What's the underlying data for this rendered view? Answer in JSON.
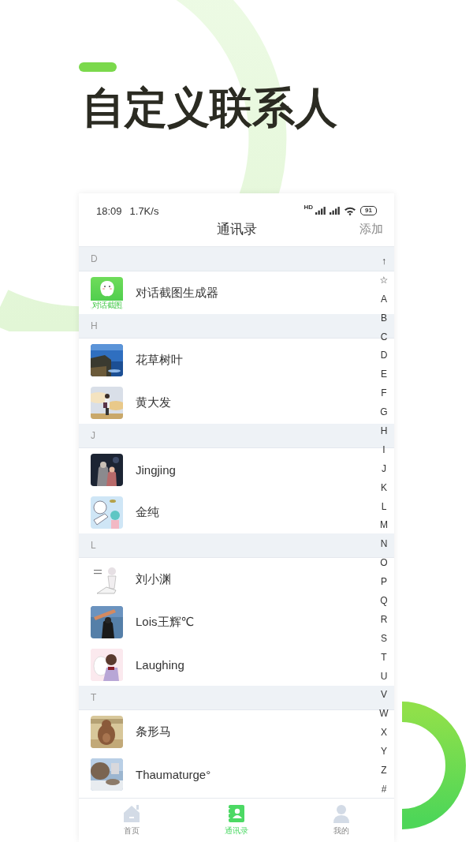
{
  "headline": "自定义联系人",
  "status_bar": {
    "time": "18:09",
    "speed": "1.7K/s",
    "network_badge": "HD",
    "battery": "91"
  },
  "header": {
    "title": "通讯录",
    "action": "添加"
  },
  "sections": [
    {
      "letter": "D",
      "contacts": [
        {
          "name": "对话截图生成器",
          "avatar": {
            "kind": "logo",
            "text": "对话截图"
          }
        }
      ]
    },
    {
      "letter": "H",
      "contacts": [
        {
          "name": "花草树叶"
        },
        {
          "name": "黄大发"
        }
      ]
    },
    {
      "letter": "J",
      "contacts": [
        {
          "name": "Jingjing"
        },
        {
          "name": "金纯"
        }
      ]
    },
    {
      "letter": "L",
      "contacts": [
        {
          "name": "刘小渊"
        },
        {
          "name": "Lois王辉℃"
        },
        {
          "name": "Laughing"
        }
      ]
    },
    {
      "letter": "T",
      "contacts": [
        {
          "name": "条形马"
        },
        {
          "name": "Thaumaturge°"
        }
      ]
    }
  ],
  "index_bar": [
    "↑",
    "☆",
    "A",
    "B",
    "C",
    "D",
    "E",
    "F",
    "G",
    "H",
    "I",
    "J",
    "K",
    "L",
    "M",
    "N",
    "O",
    "P",
    "Q",
    "R",
    "S",
    "T",
    "U",
    "V",
    "W",
    "X",
    "Y",
    "Z",
    "#"
  ],
  "tab_bar": [
    {
      "label": "首页",
      "selected": false
    },
    {
      "label": "通讯录",
      "selected": true
    },
    {
      "label": "我的",
      "selected": false
    }
  ]
}
